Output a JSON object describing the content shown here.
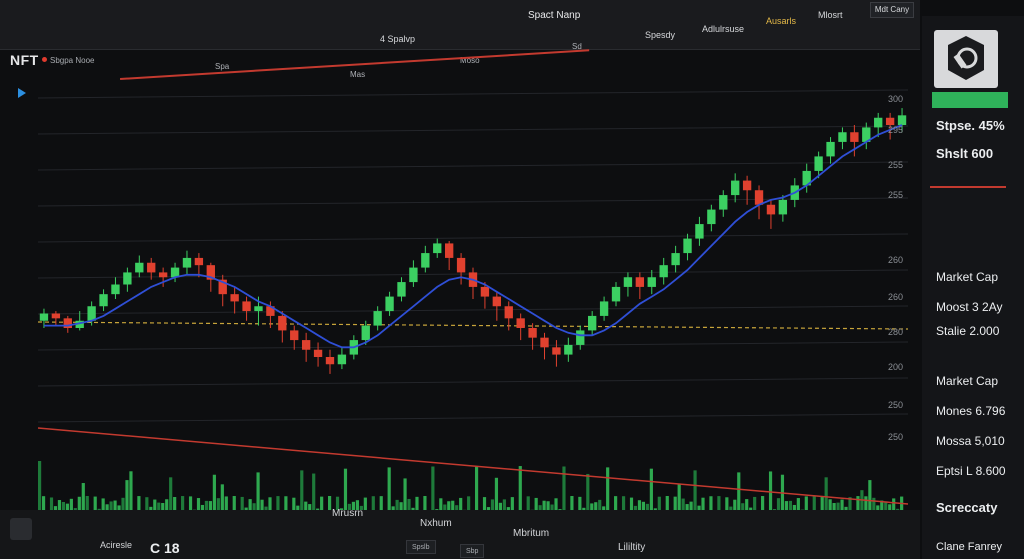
{
  "header": {
    "logo": "NFT",
    "logo_sub": "Sbgpa Nooe",
    "center_title": "Spact Nanp",
    "tabs": [
      {
        "label": "4 Spalvp",
        "accent": false
      },
      {
        "label": "Spesdy",
        "accent": false
      },
      {
        "label": "Adlulrsuse",
        "accent": false
      },
      {
        "label": "Ausarls",
        "accent": true
      },
      {
        "label": "Mlosrt",
        "accent": false
      },
      {
        "label": "Mdt Cany",
        "accent": false
      }
    ],
    "subtabs": [
      "Spa",
      "Mas",
      "Sd",
      "Moso"
    ]
  },
  "right_panel": {
    "stats": [
      {
        "label": "Stpse.",
        "value": "45%"
      },
      {
        "label": "Shslt",
        "value": "600"
      }
    ],
    "market_cap_1": "Market Cap",
    "row_1": "Moost 3 2Ay",
    "row_2": "Stalie 2.000",
    "market_cap_2": "Market Cap",
    "row_3": "Mones 6.796",
    "row_4": "Mossa 5,010",
    "row_5": "Eptsi L 8.600",
    "screen_label": "Screccaty",
    "footer": "Clane Fanrey",
    "axis_ticks": [
      "300",
      "295",
      "255",
      "255",
      "260",
      "260",
      "280",
      "200",
      "250",
      "250"
    ]
  },
  "footer": {
    "left_label": "Aciresle",
    "price_label": "C 18",
    "x_labels": [
      "Mrusrn",
      "Nxhum",
      "Mbritum",
      "Lililtity"
    ],
    "buttons": [
      "Spslb",
      "Sbp"
    ]
  },
  "chart_data": {
    "type": "candlestick",
    "y_ticks": [
      "300",
      "295",
      "255",
      "255",
      "260",
      "260",
      "280",
      "200",
      "250",
      "250"
    ],
    "reference_line_color": "#c7a43a",
    "moving_average_color": "#2f4fd6",
    "volume_colors": {
      "up": "#2ea84f",
      "down": "#1e7a3a"
    },
    "candles": [
      [
        52,
        55,
        49,
        57
      ],
      [
        55,
        53,
        50,
        56
      ],
      [
        53,
        49,
        47,
        54
      ],
      [
        49,
        52,
        48,
        56
      ],
      [
        52,
        58,
        50,
        60
      ],
      [
        58,
        63,
        56,
        65
      ],
      [
        63,
        67,
        61,
        70
      ],
      [
        67,
        72,
        64,
        74
      ],
      [
        72,
        76,
        70,
        79
      ],
      [
        76,
        72,
        69,
        78
      ],
      [
        72,
        70,
        66,
        74
      ],
      [
        70,
        74,
        68,
        76
      ],
      [
        74,
        78,
        71,
        81
      ],
      [
        78,
        75,
        70,
        80
      ],
      [
        75,
        69,
        64,
        76
      ],
      [
        69,
        63,
        58,
        71
      ],
      [
        63,
        60,
        55,
        66
      ],
      [
        60,
        56,
        52,
        62
      ],
      [
        56,
        58,
        50,
        62
      ],
      [
        58,
        54,
        49,
        60
      ],
      [
        54,
        48,
        43,
        56
      ],
      [
        48,
        44,
        40,
        50
      ],
      [
        44,
        40,
        35,
        47
      ],
      [
        40,
        37,
        33,
        43
      ],
      [
        37,
        34,
        30,
        40
      ],
      [
        34,
        38,
        32,
        41
      ],
      [
        38,
        44,
        36,
        46
      ],
      [
        44,
        50,
        42,
        52
      ],
      [
        50,
        56,
        48,
        58
      ],
      [
        56,
        62,
        54,
        64
      ],
      [
        62,
        68,
        60,
        70
      ],
      [
        68,
        74,
        66,
        77
      ],
      [
        74,
        80,
        72,
        83
      ],
      [
        80,
        84,
        78,
        86
      ],
      [
        84,
        78,
        73,
        85
      ],
      [
        78,
        72,
        67,
        80
      ],
      [
        72,
        66,
        61,
        74
      ],
      [
        66,
        62,
        57,
        68
      ],
      [
        62,
        58,
        52,
        64
      ],
      [
        58,
        53,
        48,
        60
      ],
      [
        53,
        49,
        44,
        55
      ],
      [
        49,
        45,
        40,
        51
      ],
      [
        45,
        41,
        36,
        47
      ],
      [
        41,
        38,
        33,
        44
      ],
      [
        38,
        42,
        35,
        45
      ],
      [
        42,
        48,
        40,
        50
      ],
      [
        48,
        54,
        46,
        56
      ],
      [
        54,
        60,
        52,
        62
      ],
      [
        60,
        66,
        58,
        68
      ],
      [
        66,
        70,
        62,
        72
      ],
      [
        70,
        66,
        61,
        72
      ],
      [
        66,
        70,
        63,
        73
      ],
      [
        70,
        75,
        67,
        78
      ],
      [
        75,
        80,
        72,
        83
      ],
      [
        80,
        86,
        77,
        88
      ],
      [
        86,
        92,
        83,
        95
      ],
      [
        92,
        98,
        89,
        100
      ],
      [
        98,
        104,
        95,
        106
      ],
      [
        104,
        110,
        101,
        113
      ],
      [
        110,
        106,
        100,
        112
      ],
      [
        106,
        100,
        94,
        108
      ],
      [
        100,
        96,
        90,
        102
      ],
      [
        96,
        102,
        93,
        104
      ],
      [
        102,
        108,
        99,
        111
      ],
      [
        108,
        114,
        105,
        117
      ],
      [
        114,
        120,
        111,
        122
      ],
      [
        120,
        126,
        117,
        128
      ],
      [
        126,
        130,
        123,
        132
      ],
      [
        130,
        126,
        120,
        133
      ],
      [
        126,
        132,
        123,
        134
      ],
      [
        132,
        136,
        128,
        138
      ],
      [
        136,
        133,
        127,
        138
      ],
      [
        133,
        137,
        130,
        140
      ]
    ],
    "ma": [
      50,
      50,
      50,
      51,
      52,
      54,
      57,
      60,
      63,
      66,
      68,
      70,
      71,
      71,
      70,
      68,
      66,
      63,
      60,
      58,
      55,
      52,
      49,
      46,
      43,
      41,
      41,
      43,
      46,
      50,
      54,
      58,
      62,
      66,
      69,
      70,
      69,
      67,
      64,
      61,
      58,
      55,
      52,
      49,
      47,
      46,
      46,
      48,
      51,
      55,
      59,
      62,
      65,
      69,
      73,
      78,
      83,
      88,
      93,
      97,
      100,
      102,
      103,
      105,
      108,
      112,
      116,
      120,
      123,
      126,
      129,
      131,
      133
    ]
  }
}
